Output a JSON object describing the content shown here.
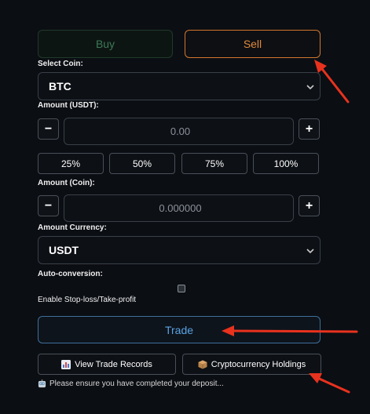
{
  "tabs": {
    "buy_label": "Buy",
    "sell_label": "Sell"
  },
  "coin": {
    "label": "Select Coin:",
    "value": "BTC"
  },
  "amount_usdt": {
    "label": "Amount (USDT):",
    "value": "0.00",
    "minus": "−",
    "plus": "+"
  },
  "percent_buttons": [
    "25%",
    "50%",
    "75%",
    "100%"
  ],
  "amount_coin": {
    "label": "Amount (Coin):",
    "value": "0.000000",
    "minus": "−",
    "plus": "+"
  },
  "currency": {
    "label": "Amount Currency:",
    "value": "USDT"
  },
  "auto_conversion": {
    "label": "Auto-conversion:"
  },
  "stop_loss": {
    "label": "Enable Stop-loss/Take-profit",
    "checked": false
  },
  "trade": {
    "label": "Trade"
  },
  "records": {
    "label": "View Trade Records",
    "icon": "chart-icon"
  },
  "holdings": {
    "label": "Cryptocurrency Holdings",
    "icon": "package-icon"
  },
  "notice": {
    "text": "Please ensure you have completed your deposit...",
    "icon": "robot-icon"
  },
  "colors": {
    "background": "#0b0e13",
    "buy": "#3c7a57",
    "sell": "#e08a3e",
    "trade": "#5aa3e3",
    "annotation_arrow": "#e8321e"
  }
}
